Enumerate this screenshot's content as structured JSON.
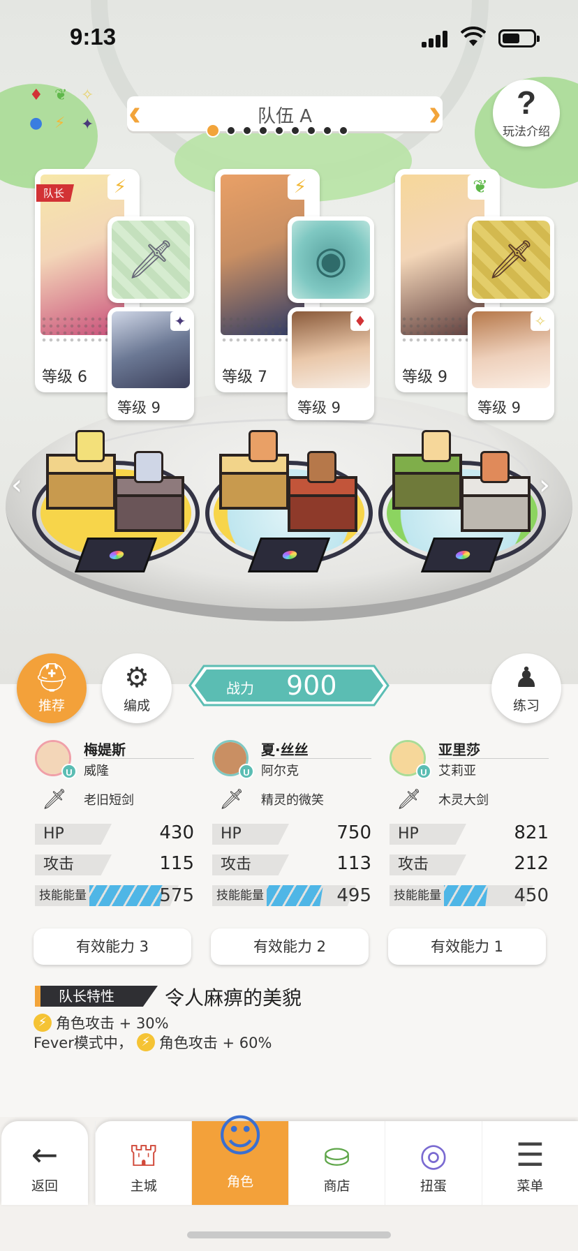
{
  "status_bar": {
    "time": "9:13"
  },
  "team": {
    "name": "队伍 A",
    "page_count": 9,
    "current_page": 1
  },
  "help": {
    "icon": "?",
    "label": "玩法介绍"
  },
  "element_chart": [
    "♦",
    "⚡",
    "❦",
    "✦",
    "●",
    "✧"
  ],
  "units": [
    {
      "leader_tag": "队长",
      "element": "⚡",
      "element_color": "#f2b93a",
      "level": "等级 6",
      "portrait_color": "#f3d6b8",
      "weapon_bg": "#cfe8c9",
      "weapon_icon": "🗡",
      "sub_element": "✦",
      "sub_element_color": "#4a3a7a",
      "sub_level": "等级 9",
      "sub_color": "#5d6b8c"
    },
    {
      "leader_tag": "",
      "element": "⚡",
      "element_color": "#f2b93a",
      "level": "等级 7",
      "portrait_color": "#c98f63",
      "weapon_bg": "#7fc8c2",
      "weapon_icon": "◉",
      "sub_element": "♦",
      "sub_element_color": "#d23235",
      "sub_level": "等级 9",
      "sub_color": "#e9c7a9"
    },
    {
      "leader_tag": "",
      "element": "❦",
      "element_color": "#5fb84a",
      "level": "等级 9",
      "portrait_color": "#f6d79a",
      "weapon_bg": "#d8bf55",
      "weapon_icon": "🗡",
      "sub_element": "✧",
      "sub_element_color": "#e9d36a",
      "sub_level": "等级 9",
      "sub_color": "#eed0bb"
    }
  ],
  "actions": {
    "recommend": "推荐",
    "formation": "编成",
    "practice": "练习"
  },
  "power": {
    "label": "战力",
    "value": "900"
  },
  "characters": [
    {
      "name": "梅媞斯",
      "sub_name": "威隆",
      "weapon": "老旧短剑",
      "hp_label": "HP",
      "hp": "430",
      "atk_label": "攻击",
      "atk": "115",
      "skill_label": "技能能量",
      "skill": "575",
      "skill_fill": 0.82,
      "ability": "有效能力 3",
      "avatar_color": "#f3d6b8",
      "ring_color": "#f0a0a8"
    },
    {
      "name": "夏·丝丝",
      "sub_name": "阿尔克",
      "weapon": "精灵的微笑",
      "hp_label": "HP",
      "hp": "750",
      "atk_label": "攻击",
      "atk": "113",
      "skill_label": "技能能量",
      "skill": "495",
      "skill_fill": 0.6,
      "ability": "有效能力 2",
      "avatar_color": "#c98f63",
      "ring_color": "#7fc8c2"
    },
    {
      "name": "亚里莎",
      "sub_name": "艾莉亚",
      "weapon": "木灵大剑",
      "hp_label": "HP",
      "hp": "821",
      "atk_label": "攻击",
      "atk": "212",
      "skill_label": "技能能量",
      "skill": "450",
      "skill_fill": 0.45,
      "ability": "有效能力 1",
      "avatar_color": "#f6d79a",
      "ring_color": "#a9dc95"
    }
  ],
  "leader_trait": {
    "label": "队长特性",
    "name": "令人麻痹的美貌",
    "effects": [
      "角色攻击 + 30%",
      "角色攻击 + 60%"
    ],
    "fever_prefix": "Fever模式中，"
  },
  "nav": {
    "back": "返回",
    "tabs": [
      {
        "label": "主城",
        "icon": "⛫",
        "active": false
      },
      {
        "label": "角色",
        "icon": "☺",
        "active": true
      },
      {
        "label": "商店",
        "icon": "⛀",
        "active": false
      },
      {
        "label": "扭蛋",
        "icon": "◎",
        "active": false
      },
      {
        "label": "菜单",
        "icon": "☰",
        "active": false
      }
    ]
  },
  "colors": {
    "accent": "#f3a13a",
    "power": "#5bbdb3",
    "skill_bar": "#4fb6e6",
    "leader_red": "#d23235"
  }
}
